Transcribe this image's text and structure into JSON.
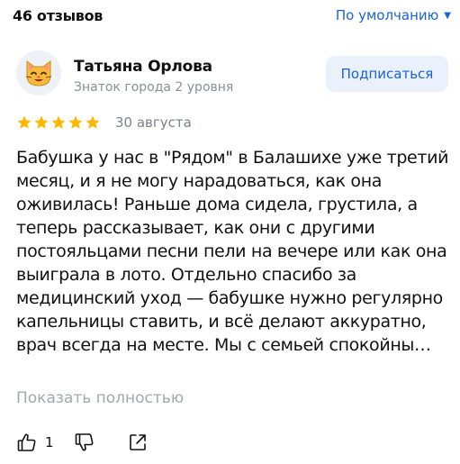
{
  "header": {
    "reviews_count": "46 отзывов",
    "sort_label": "По умолчанию",
    "sort_caret": "▼"
  },
  "author": {
    "avatar_icon": "cat-face-icon",
    "name": "Татьяна Орлова",
    "level": "Знаток города 2 уровня",
    "subscribe_label": "Подписаться"
  },
  "review": {
    "rating": 5,
    "rating_max": 5,
    "date": "30 августа",
    "text": "Бабушка у нас в \"Рядом\" в Балашихе уже третий месяц, и я не могу нарадоваться, как она оживилась! Раньше дома сидела, грустила, а теперь рассказывает, как они с другими постояльцами песни пели на вечере или как она выиграла в лото. Отдельно спасибо за медицинский уход — бабушке нужно регулярно капельницы ставить, и всё делают аккуратно, врач всегда на месте. Мы с семьей спокойны…",
    "show_full_label": "Показать полностью"
  },
  "actions": {
    "like_icon": "thumbs-up-icon",
    "like_count": "1",
    "dislike_icon": "thumbs-down-icon",
    "share_icon": "share-icon"
  },
  "colors": {
    "accent": "#1a62d9",
    "subscribe_bg": "#eaf1fd",
    "star": "#fdb900",
    "muted": "#8a8f96"
  }
}
